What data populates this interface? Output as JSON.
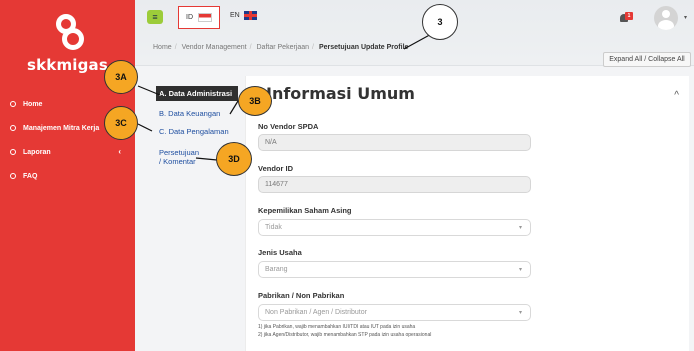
{
  "sidebar": {
    "logo_text": "skkmigas",
    "items": [
      {
        "label": "Home",
        "icon": "home-icon"
      },
      {
        "label": "Manajemen Mitra Kerja",
        "icon": "partner-icon"
      },
      {
        "label": "Laporan",
        "icon": "report-icon",
        "caret": "‹"
      },
      {
        "label": "FAQ",
        "icon": "faq-icon"
      }
    ]
  },
  "header": {
    "menu_icon": "≡",
    "lang_id": "ID",
    "lang_en": "EN",
    "notification_count": "1",
    "breadcrumb": [
      "Home",
      "Vendor Management",
      "Daftar Pekerjaan",
      "Persetujuan Update Profile"
    ],
    "expand_collapse_label": "Expand All / Collapse All"
  },
  "tabs": [
    {
      "label": "A. Data Administrasi",
      "active": true
    },
    {
      "label": "B. Data Keuangan"
    },
    {
      "label": "C. Data Pengalaman"
    },
    {
      "label_line1": "Persetujuan",
      "label_line2": "/ Komentar"
    }
  ],
  "form": {
    "title": "Informasi Umum",
    "fields": [
      {
        "label": "No Vendor SPDA",
        "value": "N/A",
        "type": "readonly"
      },
      {
        "label": "Vendor ID",
        "value": "114677",
        "type": "readonly"
      },
      {
        "label": "Kepemilikan Saham Asing",
        "value": "Tidak",
        "type": "select"
      },
      {
        "label": "Jenis Usaha",
        "value": "Barang",
        "type": "select"
      },
      {
        "label": "Pabrikan / Non Pabrikan",
        "value": "Non Pabrikan / Agen / Distributor",
        "type": "select"
      }
    ],
    "notes": [
      "1) jika Pabrikan, wajib menambahkan IUI/TDI atau IUT pada izin usaha",
      "2) jika Agen/Distributor, wajib menambahkan STP pada izin usaha operasional"
    ]
  },
  "callouts": [
    "3",
    "3A",
    "3B",
    "3C",
    "3D"
  ],
  "colors": {
    "sidebar": "#e53935",
    "callout": "#f5a623",
    "accent_green": "#9ccc3a",
    "active_tab": "#2f2f2f"
  }
}
